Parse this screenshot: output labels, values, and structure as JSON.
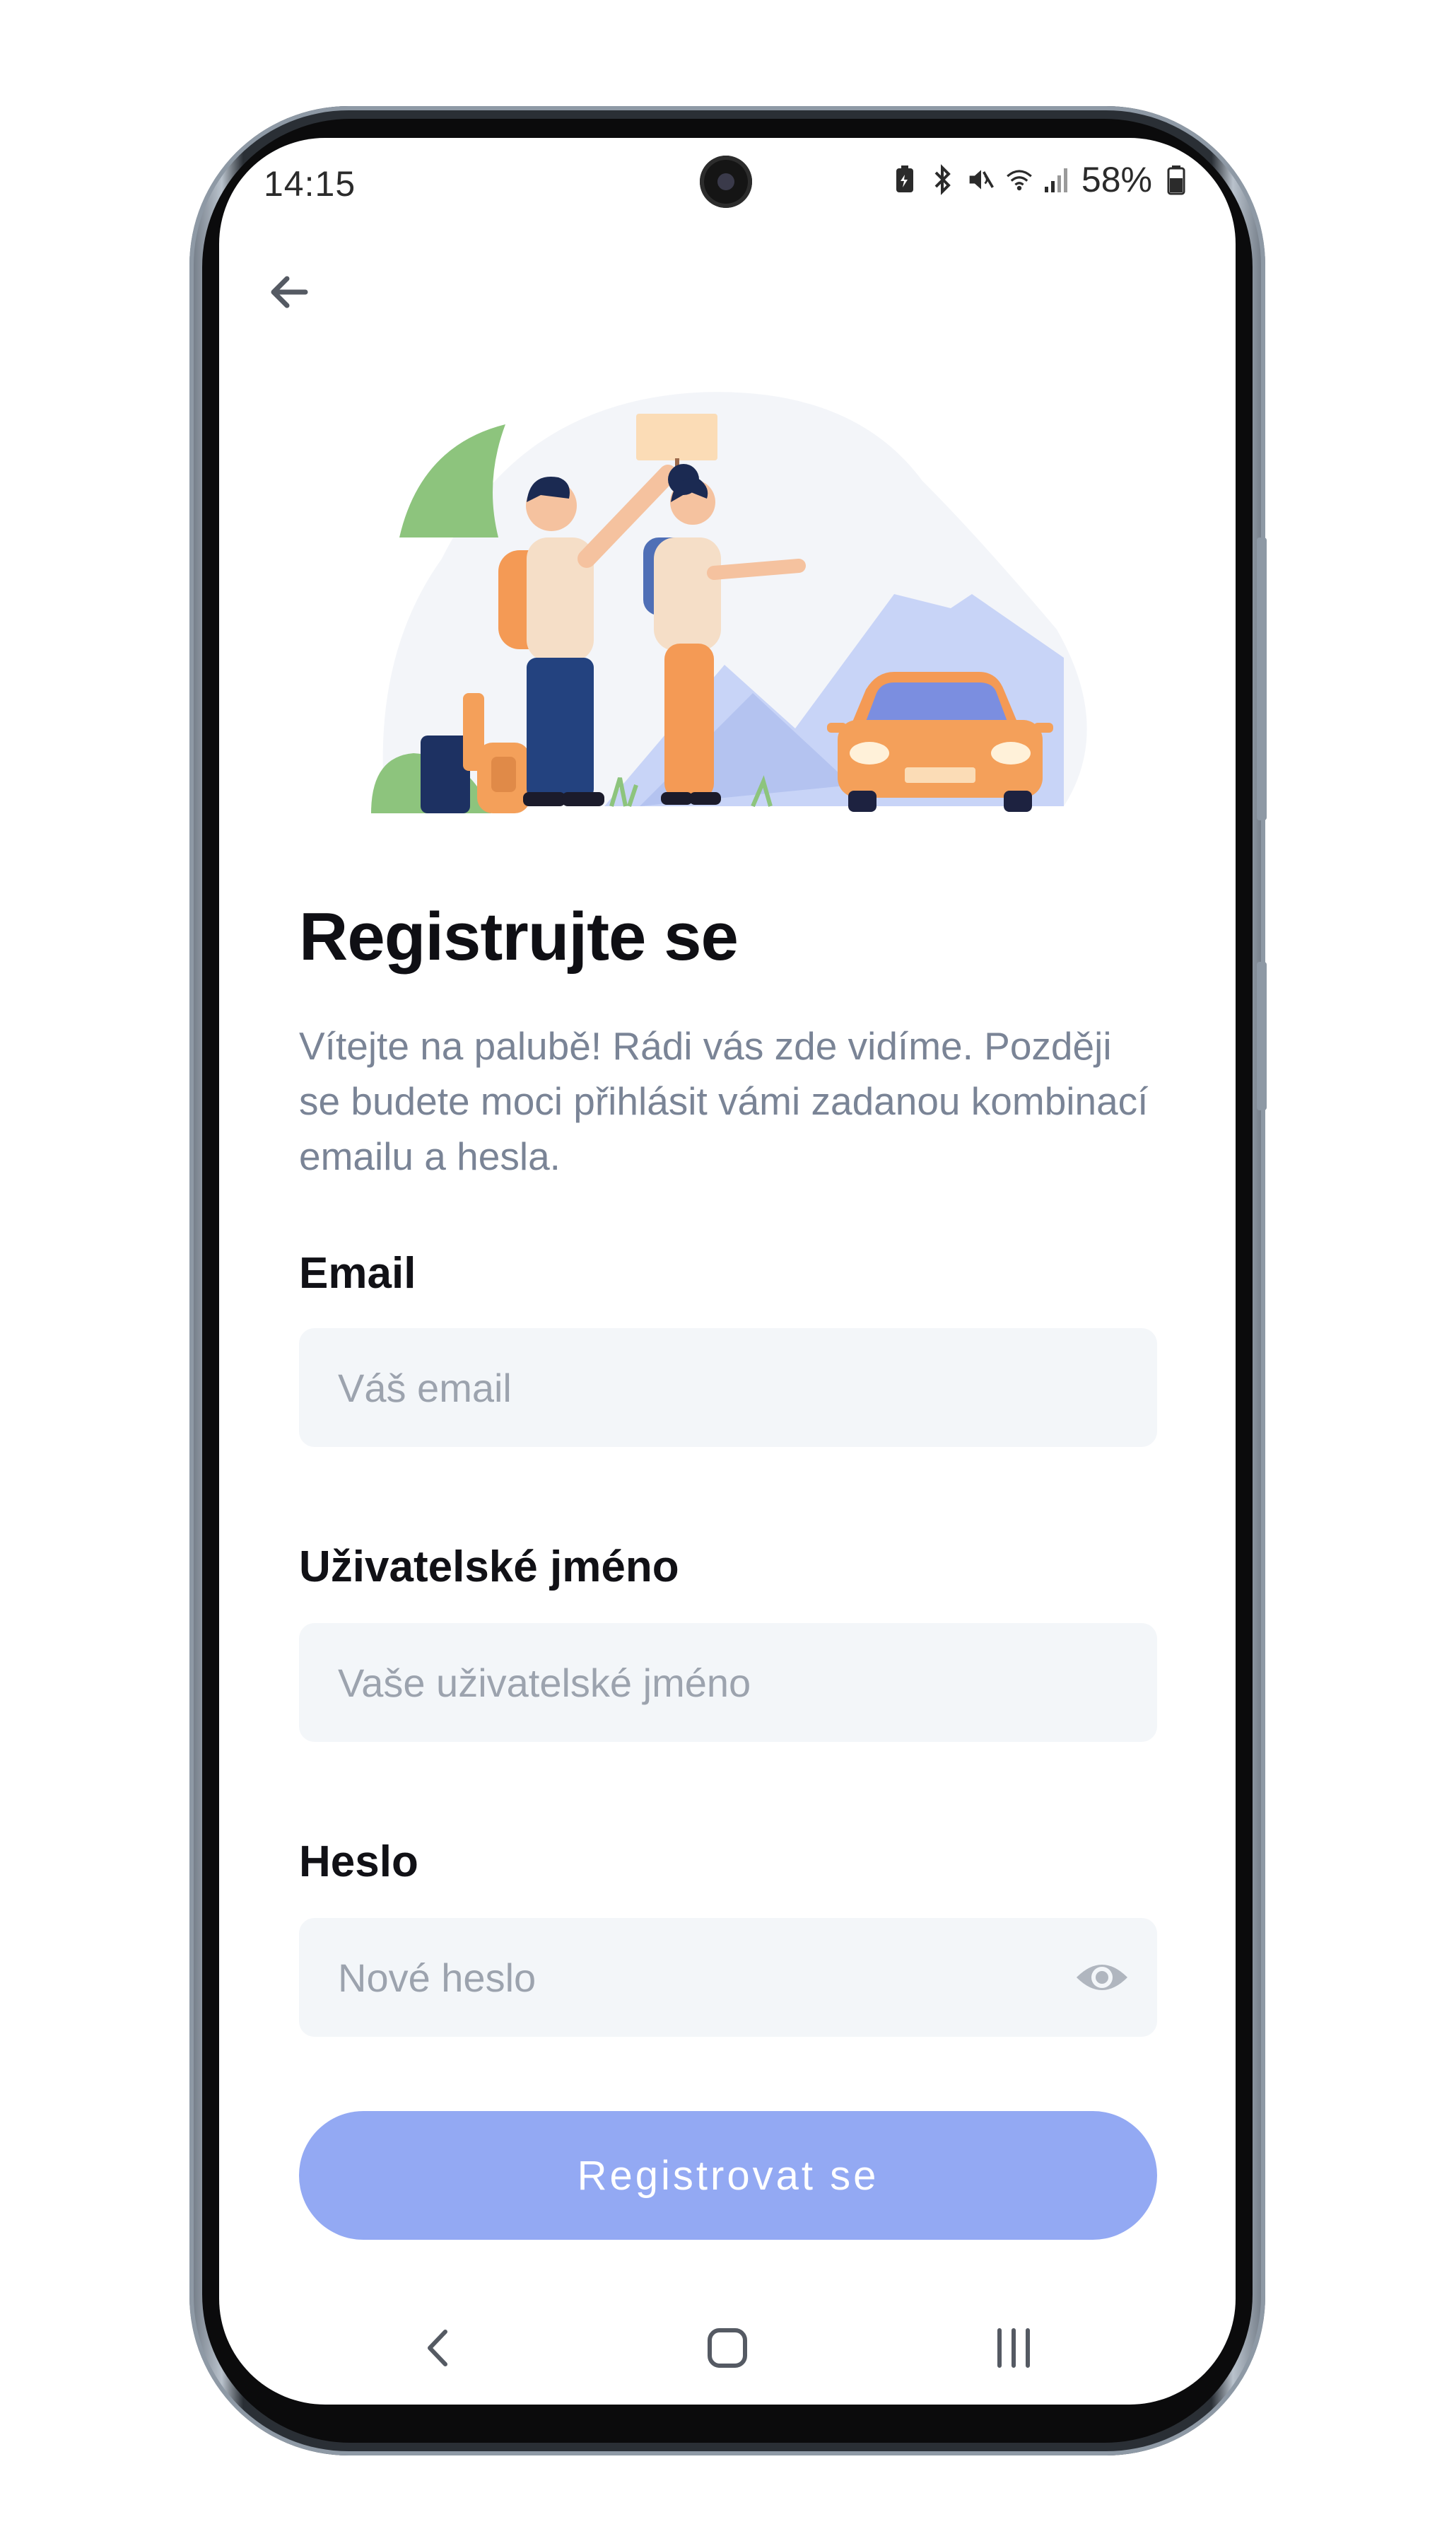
{
  "status_bar": {
    "time": "14:15",
    "battery": "58%",
    "icons": [
      "battery-saver-icon",
      "bluetooth-icon",
      "mute-icon",
      "wifi-icon",
      "signal-icon",
      "battery-icon"
    ]
  },
  "header": {
    "back_icon": "arrow-left-icon"
  },
  "page": {
    "title": "Registrujte se",
    "subtitle": "Vítejte na palubě! Rádi vás zde vidíme. Později se budete moci přihlásit vámi zadanou kombinací emailu a hesla."
  },
  "form": {
    "email": {
      "label": "Email",
      "placeholder": "Váš email",
      "value": ""
    },
    "username": {
      "label": "Uživatelské jméno",
      "placeholder": "Vaše uživatelské jméno",
      "value": ""
    },
    "password": {
      "label": "Heslo",
      "placeholder": "Nové heslo",
      "value": "",
      "toggle_icon": "eye-icon"
    },
    "submit_label": "Registrovat se"
  },
  "colors": {
    "accent": "#93a9f3",
    "input_bg": "#f3f6f9",
    "subtitle": "#7a8496",
    "title": "#0f0f14"
  },
  "navigation_bar": {
    "items": [
      "back-nav-icon",
      "home-nav-icon",
      "recents-nav-icon"
    ]
  }
}
